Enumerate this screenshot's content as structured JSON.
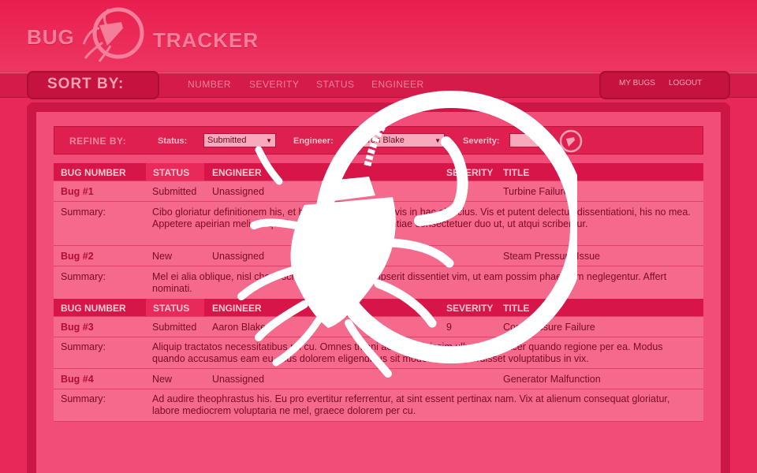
{
  "header": {
    "logo_word_a": "BUG",
    "logo_word_b": "TRACKER"
  },
  "sort": {
    "label": "SORT BY:",
    "options": [
      "NUMBER",
      "SEVERITY",
      "STATUS",
      "ENGINEER"
    ]
  },
  "user_menu": {
    "my_bugs": "MY BUGS",
    "logout": "LOGOUT"
  },
  "refine": {
    "label": "REFINE BY:",
    "status_label": "Status:",
    "status_value": "Submitted",
    "engineer_label": "Engineer:",
    "engineer_value": "Aaron Blake",
    "severity_label": "Severity:",
    "severity_value": ""
  },
  "table": {
    "columns": [
      "BUG NUMBER",
      "STATUS",
      "ENGINEER",
      "SEVERITY",
      "TITLE"
    ],
    "summary_label": "Summary:",
    "bugs": [
      {
        "number": "Bug #1",
        "status": "Submitted",
        "engineer": "Unassigned",
        "severity": "",
        "title": "Turbine Failure",
        "summary": "Cibo gloriatur definitionem his, et his mnesarchum sea, vis in hac albucius. Vis et putent delectus dissentiationi, his no mea. Appetere apeirian meliore qualisque omnium no, sententiae consectetuer duo ut, ut atqui scribentur."
      },
      {
        "number": "Bug #2",
        "status": "New",
        "engineer": "Unassigned",
        "severity": "",
        "title": "Steam Pressure Issue",
        "summary": "Mel ei alia oblique, nisl choro scriptorem eos, ne scripserit dissentiet vim, ut eam possim phaedrum neglegentur. Affert nominati."
      },
      {
        "number": "Bug #3",
        "status": "Submitted",
        "engineer": "Aaron Blake",
        "severity": "9",
        "title": "Compressure Failure",
        "summary": "Aliquip tractatos necessitatibus pri cu. Omnes tritani aeque dignissim ullum rem, facer quando regione per ea. Modus quando accusamus eam eu, eius dolorem eligendi ius sit moderatius deterruisset voluptatibus in vix."
      },
      {
        "number": "Bug #4",
        "status": "New",
        "engineer": "Unassigned",
        "severity": "",
        "title": "Generator Malfunction",
        "summary": "Ad audire theophrastus his. Eu pro evertitur referrentur, at sint essent pertinax nam. Vix at alienum consequat gloriatur, labore mediocrem voluptaria ne mel, graece dolorem per cu."
      }
    ]
  },
  "colors": {
    "background": "#ea2a57",
    "accent_dark": "#c5133f",
    "overlay": "#ffffff"
  }
}
